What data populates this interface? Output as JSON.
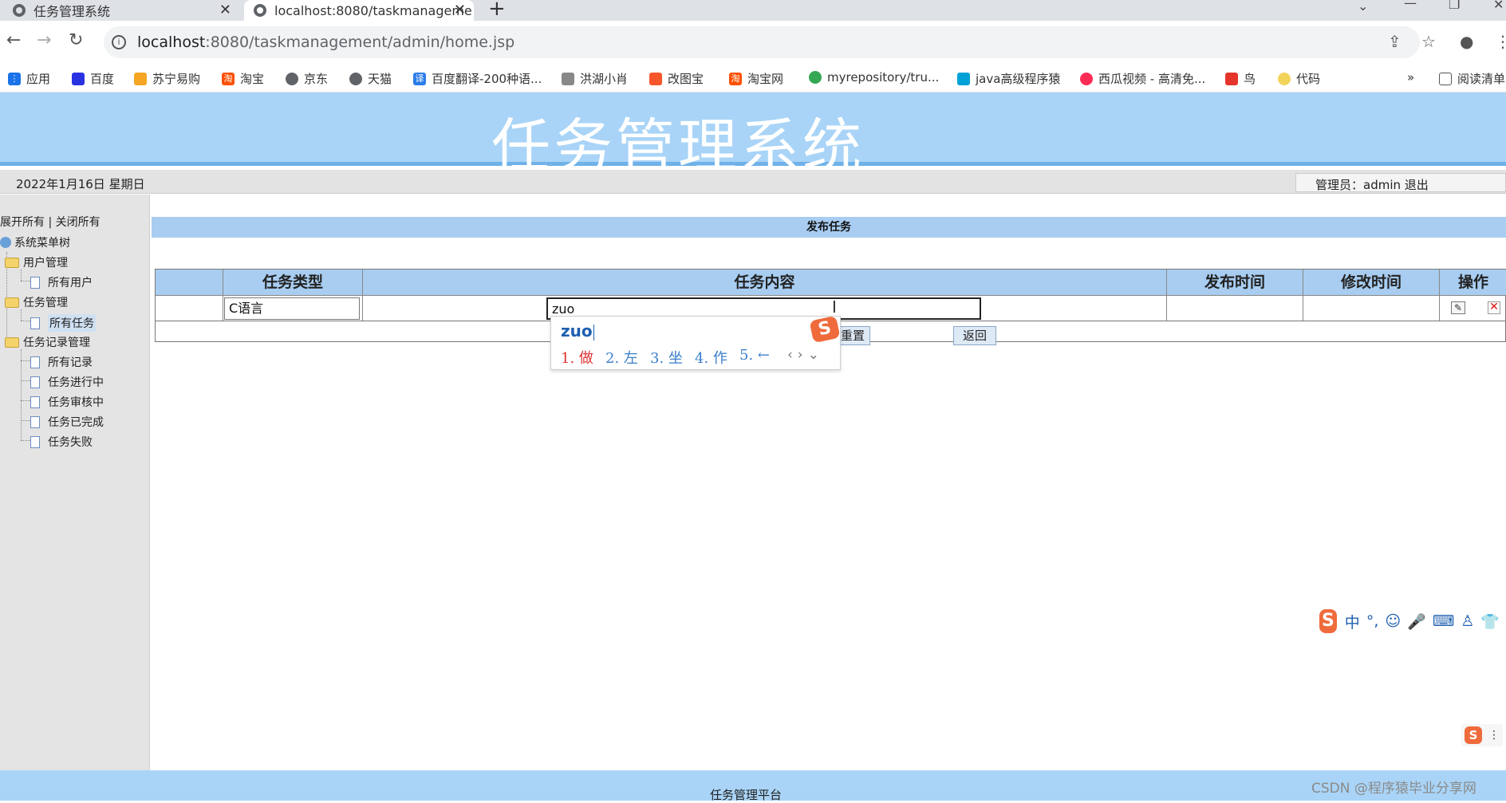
{
  "browser": {
    "tabs": [
      {
        "title": "任务管理系统"
      },
      {
        "title": "localhost:8080/taskmanageme"
      }
    ],
    "new_tab_icon": "plus-icon",
    "url_host": "localhost",
    "url_rest": ":8080/taskmanagement/admin/home.jsp",
    "bookmarks": [
      {
        "label": "应用",
        "color": "#1a73e8"
      },
      {
        "label": "百度",
        "color": "#2932e1"
      },
      {
        "label": "苏宁易购",
        "color": "#f5a623"
      },
      {
        "label": "淘宝",
        "color": "#ff5000"
      },
      {
        "label": "京东",
        "color": "#5f6368"
      },
      {
        "label": "天猫",
        "color": "#5f6368"
      },
      {
        "label": "百度翻译-200种语...",
        "color": "#2b7de9"
      },
      {
        "label": "洪湖小肖",
        "color": "#888888"
      },
      {
        "label": "改图宝",
        "color": "#f7562b"
      },
      {
        "label": "淘宝网",
        "color": "#ff5000"
      },
      {
        "label": "myrepository/tru...",
        "color": "#34a853"
      },
      {
        "label": "java高级程序猿",
        "color": "#00a1d6"
      },
      {
        "label": "西瓜视频 - 高清免...",
        "color": "#fe2c55"
      },
      {
        "label": "鸟",
        "color": "#e5352b"
      },
      {
        "label": "代码",
        "color": "#f2d35b"
      }
    ],
    "bookmarks_more": "»",
    "reading_list": "阅读清单"
  },
  "header": {
    "title": "任务管理系统"
  },
  "status": {
    "date": "2022年1月16日 星期日",
    "admin_text": "管理员：admin 退出"
  },
  "sidebar": {
    "expand_all": "展开所有",
    "separator": "|",
    "collapse_all": "关闭所有",
    "root": "系统菜单树",
    "groups": [
      {
        "label": "用户管理",
        "items": [
          "所有用户"
        ]
      },
      {
        "label": "任务管理",
        "items": [
          "所有任务"
        ]
      },
      {
        "label": "任务记录管理",
        "items": [
          "所有记录",
          "任务进行中",
          "任务审核中",
          "任务已完成",
          "任务失败"
        ]
      }
    ]
  },
  "main": {
    "section_title": "发布任务",
    "columns": [
      "任务类型",
      "任务内容",
      "发布时间",
      "修改时间",
      "操作"
    ],
    "row": {
      "task_type": "C语言",
      "task_content": "zuo"
    },
    "buttons": {
      "reset": "重置",
      "back": "返回"
    }
  },
  "ime": {
    "pinyin": "zuo",
    "candidates": [
      "1. 做",
      "2. 左",
      "3. 坐",
      "4. 作",
      "5. ←"
    ],
    "logo": "S"
  },
  "sogou_toolbar": {
    "logo": "S",
    "mode": "中",
    "punct": "°,"
  },
  "footer": {
    "text": "任务管理平台"
  },
  "watermark": "CSDN @程序猿毕业分享网"
}
